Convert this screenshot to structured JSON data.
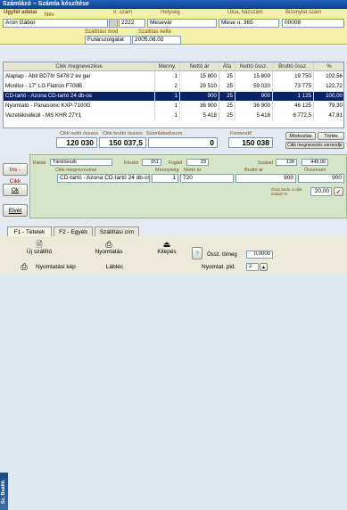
{
  "window": {
    "title": "Számlázó – Számla készítése"
  },
  "header": {
    "labels": {
      "name": "Ügyfél adatai",
      "nev": "Név",
      "irsz": "Ir. szám",
      "city": "Helység",
      "street": "Utca, házszám",
      "doc": "Bizonylat szám",
      "payment": "Szállítási mód",
      "date": "Szállítás kelte"
    },
    "name": "Aron Gábor",
    "zip": "2222",
    "city": "Mesevár",
    "street": "Mese u. 365",
    "doc_no": "00008",
    "payment": "Futárszolgálat",
    "date": "2005.08.02"
  },
  "grid": {
    "headers": [
      "Cikk megnevezése",
      "Menny.",
      "Nettó ár",
      "Áfa",
      "Nettó össz.",
      "Bruttó össz.",
      "%"
    ],
    "rows": [
      [
        "Alaplap - Abit BD7III  S478  2 év gar",
        "1",
        "15 800",
        "25",
        "15 800",
        "19 750",
        "102,56"
      ],
      [
        "Monitor - 17\" LG Flatron F700B",
        "2",
        "29 510",
        "25",
        "59 020",
        "73 775",
        "122,72"
      ],
      [
        "CD-tartó - Azona CD-tartó 24 db-os",
        "1",
        "900",
        "25",
        "900",
        "1 125",
        "100,00"
      ],
      [
        "Nyomtató - Panasonic KXP-7100G",
        "1",
        "36 900",
        "25",
        "36 900",
        "46 125",
        "79,30"
      ],
      [
        "Vezetéknélküli - MS KHR 27Y1",
        "1",
        "5 418",
        "25",
        "5 418",
        "6 772,5",
        "47,81"
      ]
    ]
  },
  "totals": {
    "labels": {
      "net": "Cikk nettó összes",
      "gross": "Cikk bruttó összes",
      "discount": "Számlakedvezm.",
      "pay": "Fizetendő"
    },
    "net": "120 030",
    "gross": "150 037,5",
    "discount": "0",
    "pay": "150 038",
    "btn_modify": "Módosítás",
    "btn_delete": "Törlés",
    "btn_reorder": "Cikk megnevezés sorrendje"
  },
  "left_buttons": {
    "ins": "Ins - Cikk",
    "ok": "Ok",
    "cancel": "Elvet"
  },
  "edit": {
    "labels": {
      "raktar": "Raktár",
      "keszlet": "Készlet",
      "foglalt": "Foglalt",
      "szabad": "Szabad",
      "cikk": "Cikk megnevezése",
      "menny": "Mennyiség",
      "netto": "Nettó ár",
      "brutto": "Bruttó ár",
      "osszesen": "Összesen",
      "osszes_kedv": "Össz.kedv. a cikk árából %"
    },
    "raktar": "Tárolóeszk",
    "keszlet": "151",
    "foglalt": "23",
    "szabad": "128",
    "szabad2": "449,00",
    "cikk": "CD-tartó - Azona CD-tartó 24 db-os",
    "menny": "1",
    "netto": "720",
    "brutto": "900",
    "osszesen": "900",
    "kedv": "20,00"
  },
  "tabs": [
    "F1 - Tételek",
    "F2 - Egyéb",
    "Szállítási cím"
  ],
  "toolbar": {
    "side": "Sz. Beállít.",
    "new_supplier": "Új szállító",
    "print": "Nyomtatás",
    "exit": "Kilépés",
    "print_preview": "Nyomtatási kép",
    "footer": "Lábléc",
    "weight_label": "Össz. tömeg",
    "weight": "0,0000",
    "copies_label": "Nyomtat. pld.",
    "copies": "2"
  },
  "colors": {
    "header_bg": "#f3f1a8",
    "selection": "#0a246a",
    "edit_panel": "#d6e4c8"
  }
}
